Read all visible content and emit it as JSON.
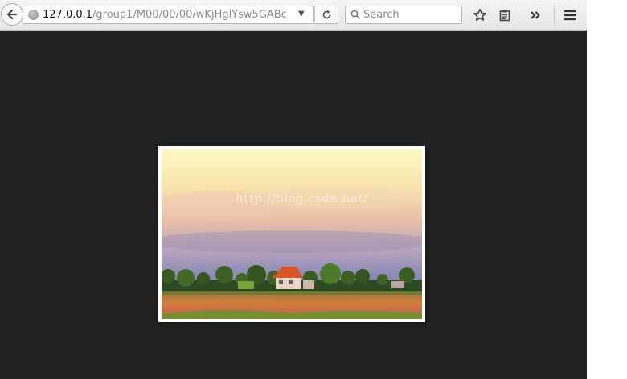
{
  "browser": {
    "address": {
      "host": "127.0.0.1",
      "path": "/group1/M00/00/00/wKjHglYsw5GABc"
    },
    "search": {
      "placeholder": "Search"
    },
    "icons": {
      "back": "back-arrow-icon",
      "site": "globe-icon",
      "dropdown": "dropdown-arrow-icon",
      "reload": "reload-icon",
      "search": "search-icon",
      "bookmark": "star-icon",
      "reading_list": "clipboard-icon",
      "overflow": "double-chevron-icon",
      "menu": "hamburger-menu-icon"
    }
  },
  "viewer": {
    "background_color": "#222222",
    "image": {
      "watermark": "http://blog.csdn.net/"
    }
  }
}
